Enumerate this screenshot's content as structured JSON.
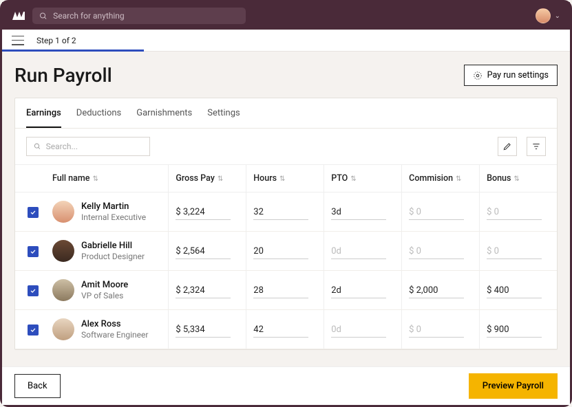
{
  "search": {
    "placeholder": "Search for anything"
  },
  "step": {
    "label": "Step 1 of 2"
  },
  "page": {
    "title": "Run Payroll",
    "settings_btn": "Pay run settings"
  },
  "tabs": [
    {
      "label": "Earnings",
      "active": true
    },
    {
      "label": "Deductions",
      "active": false
    },
    {
      "label": "Garnishments",
      "active": false
    },
    {
      "label": "Settings",
      "active": false
    }
  ],
  "table_search": {
    "placeholder": "Search..."
  },
  "columns": {
    "name": "Full name",
    "gross": "Gross Pay",
    "hours": "Hours",
    "pto": "PTO",
    "commission": "Commision",
    "bonus": "Bonus"
  },
  "rows": [
    {
      "name": "Kelly Martin",
      "role": "Internal Executive",
      "gross": "$ 3,224",
      "hours": "32",
      "pto": "3d",
      "commission": "$ 0",
      "bonus": "$ 0",
      "checked": true,
      "commission_placeholder": true,
      "bonus_placeholder": true
    },
    {
      "name": "Gabrielle Hill",
      "role": "Product Designer",
      "gross": "$ 2,564",
      "hours": "20",
      "pto": "0d",
      "commission": "$ 0",
      "bonus": "$ 0",
      "checked": true,
      "pto_placeholder": true,
      "commission_placeholder": true,
      "bonus_placeholder": true
    },
    {
      "name": "Amit Moore",
      "role": "VP of Sales",
      "gross": "$ 2,324",
      "hours": "28",
      "pto": "2d",
      "commission": "$ 2,000",
      "bonus": "$ 400",
      "checked": true
    },
    {
      "name": "Alex Ross",
      "role": "Software Engineer",
      "gross": "$ 5,334",
      "hours": "42",
      "pto": "0d",
      "commission": "$ 0",
      "bonus": "$ 900",
      "checked": true,
      "pto_placeholder": true,
      "commission_placeholder": true
    }
  ],
  "footer": {
    "back": "Back",
    "preview": "Preview Payroll"
  }
}
